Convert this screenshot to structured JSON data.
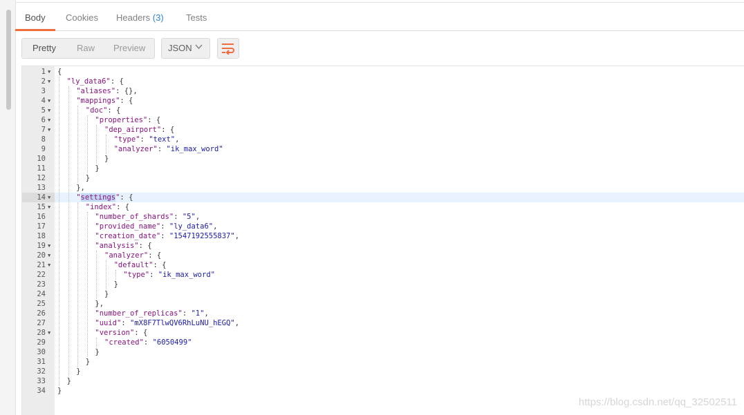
{
  "tabs": [
    {
      "label": "Body",
      "active": true
    },
    {
      "label": "Cookies",
      "active": false
    },
    {
      "label": "Headers",
      "count": "(3)",
      "active": false
    },
    {
      "label": "Tests",
      "active": false
    }
  ],
  "view_modes": {
    "pretty": "Pretty",
    "raw": "Raw",
    "preview": "Preview",
    "selected": "Pretty"
  },
  "format_select": {
    "value": "JSON"
  },
  "wrap_button": {
    "icon": "wrap-lines-icon"
  },
  "colors": {
    "accent": "#f26b3a",
    "key": "#881280",
    "string": "#1a1aa6",
    "headers_count": "#2a87d5"
  },
  "editor": {
    "active_line": 14,
    "highlight": {
      "line": 14,
      "text": "settings"
    },
    "lines": [
      {
        "n": "1",
        "fold": true,
        "indent": 0,
        "tokens": [
          [
            "p",
            "{"
          ]
        ]
      },
      {
        "n": "2",
        "fold": true,
        "indent": 1,
        "tokens": [
          [
            "k",
            "\"ly_data6\""
          ],
          [
            "p",
            ": {"
          ]
        ]
      },
      {
        "n": "3",
        "fold": false,
        "indent": 2,
        "tokens": [
          [
            "k",
            "\"aliases\""
          ],
          [
            "p",
            ": {},"
          ]
        ]
      },
      {
        "n": "4",
        "fold": true,
        "indent": 2,
        "tokens": [
          [
            "k",
            "\"mappings\""
          ],
          [
            "p",
            ": {"
          ]
        ]
      },
      {
        "n": "5",
        "fold": true,
        "indent": 3,
        "tokens": [
          [
            "k",
            "\"doc\""
          ],
          [
            "p",
            ": {"
          ]
        ]
      },
      {
        "n": "6",
        "fold": true,
        "indent": 4,
        "tokens": [
          [
            "k",
            "\"properties\""
          ],
          [
            "p",
            ": {"
          ]
        ]
      },
      {
        "n": "7",
        "fold": true,
        "indent": 5,
        "tokens": [
          [
            "k",
            "\"dep_airport\""
          ],
          [
            "p",
            ": {"
          ]
        ]
      },
      {
        "n": "8",
        "fold": false,
        "indent": 6,
        "tokens": [
          [
            "k",
            "\"type\""
          ],
          [
            "p",
            ": "
          ],
          [
            "s",
            "\"text\""
          ],
          [
            "p",
            ","
          ]
        ]
      },
      {
        "n": "9",
        "fold": false,
        "indent": 6,
        "tokens": [
          [
            "k",
            "\"analyzer\""
          ],
          [
            "p",
            ": "
          ],
          [
            "s",
            "\"ik_max_word\""
          ]
        ]
      },
      {
        "n": "10",
        "fold": false,
        "indent": 5,
        "tokens": [
          [
            "p",
            "}"
          ]
        ]
      },
      {
        "n": "11",
        "fold": false,
        "indent": 4,
        "tokens": [
          [
            "p",
            "}"
          ]
        ]
      },
      {
        "n": "12",
        "fold": false,
        "indent": 3,
        "tokens": [
          [
            "p",
            "}"
          ]
        ]
      },
      {
        "n": "13",
        "fold": false,
        "indent": 2,
        "tokens": [
          [
            "p",
            "},"
          ]
        ]
      },
      {
        "n": "14",
        "fold": true,
        "indent": 2,
        "tokens": [
          [
            "k",
            "\"settings\""
          ],
          [
            "p",
            ": {"
          ]
        ]
      },
      {
        "n": "15",
        "fold": true,
        "indent": 3,
        "tokens": [
          [
            "k",
            "\"index\""
          ],
          [
            "p",
            ": {"
          ]
        ]
      },
      {
        "n": "16",
        "fold": false,
        "indent": 4,
        "tokens": [
          [
            "k",
            "\"number_of_shards\""
          ],
          [
            "p",
            ": "
          ],
          [
            "s",
            "\"5\""
          ],
          [
            "p",
            ","
          ]
        ]
      },
      {
        "n": "17",
        "fold": false,
        "indent": 4,
        "tokens": [
          [
            "k",
            "\"provided_name\""
          ],
          [
            "p",
            ": "
          ],
          [
            "s",
            "\"ly_data6\""
          ],
          [
            "p",
            ","
          ]
        ]
      },
      {
        "n": "18",
        "fold": false,
        "indent": 4,
        "tokens": [
          [
            "k",
            "\"creation_date\""
          ],
          [
            "p",
            ": "
          ],
          [
            "s",
            "\"1547192555837\""
          ],
          [
            "p",
            ","
          ]
        ]
      },
      {
        "n": "19",
        "fold": true,
        "indent": 4,
        "tokens": [
          [
            "k",
            "\"analysis\""
          ],
          [
            "p",
            ": {"
          ]
        ]
      },
      {
        "n": "20",
        "fold": true,
        "indent": 5,
        "tokens": [
          [
            "k",
            "\"analyzer\""
          ],
          [
            "p",
            ": {"
          ]
        ]
      },
      {
        "n": "21",
        "fold": true,
        "indent": 6,
        "tokens": [
          [
            "k",
            "\"default\""
          ],
          [
            "p",
            ": {"
          ]
        ]
      },
      {
        "n": "22",
        "fold": false,
        "indent": 7,
        "tokens": [
          [
            "k",
            "\"type\""
          ],
          [
            "p",
            ": "
          ],
          [
            "s",
            "\"ik_max_word\""
          ]
        ]
      },
      {
        "n": "23",
        "fold": false,
        "indent": 6,
        "tokens": [
          [
            "p",
            "}"
          ]
        ]
      },
      {
        "n": "24",
        "fold": false,
        "indent": 5,
        "tokens": [
          [
            "p",
            "}"
          ]
        ]
      },
      {
        "n": "25",
        "fold": false,
        "indent": 4,
        "tokens": [
          [
            "p",
            "},"
          ]
        ]
      },
      {
        "n": "26",
        "fold": false,
        "indent": 4,
        "tokens": [
          [
            "k",
            "\"number_of_replicas\""
          ],
          [
            "p",
            ": "
          ],
          [
            "s",
            "\"1\""
          ],
          [
            "p",
            ","
          ]
        ]
      },
      {
        "n": "27",
        "fold": false,
        "indent": 4,
        "tokens": [
          [
            "k",
            "\"uuid\""
          ],
          [
            "p",
            ": "
          ],
          [
            "s",
            "\"mX8F7TlwQV6RhLuNU_hEGQ\""
          ],
          [
            "p",
            ","
          ]
        ]
      },
      {
        "n": "28",
        "fold": true,
        "indent": 4,
        "tokens": [
          [
            "k",
            "\"version\""
          ],
          [
            "p",
            ": {"
          ]
        ]
      },
      {
        "n": "29",
        "fold": false,
        "indent": 5,
        "tokens": [
          [
            "k",
            "\"created\""
          ],
          [
            "p",
            ": "
          ],
          [
            "s",
            "\"6050499\""
          ]
        ]
      },
      {
        "n": "30",
        "fold": false,
        "indent": 4,
        "tokens": [
          [
            "p",
            "}"
          ]
        ]
      },
      {
        "n": "31",
        "fold": false,
        "indent": 3,
        "tokens": [
          [
            "p",
            "}"
          ]
        ]
      },
      {
        "n": "32",
        "fold": false,
        "indent": 2,
        "tokens": [
          [
            "p",
            "}"
          ]
        ]
      },
      {
        "n": "33",
        "fold": false,
        "indent": 1,
        "tokens": [
          [
            "p",
            "}"
          ]
        ]
      },
      {
        "n": "34",
        "fold": false,
        "indent": 0,
        "tokens": [
          [
            "p",
            "}"
          ]
        ]
      }
    ]
  },
  "watermark": "https://blog.csdn.net/qq_32502511"
}
